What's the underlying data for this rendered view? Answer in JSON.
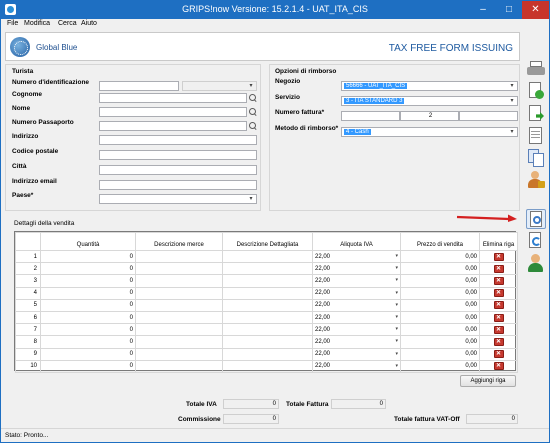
{
  "window": {
    "title": "GRIPS!now Versione: 15.2.1.4 - UAT_ITA_CIS"
  },
  "menu": {
    "items": [
      "File",
      "Modifica",
      "Cerca",
      "Aiuto"
    ]
  },
  "header": {
    "logo_text": "Global Blue",
    "form_title": "TAX FREE FORM ISSUING"
  },
  "tourist": {
    "section_label": "Turista",
    "fields": [
      {
        "label": "Numero d'identificazione",
        "value": ""
      },
      {
        "label": "Cognome",
        "value": ""
      },
      {
        "label": "Nome",
        "value": ""
      },
      {
        "label": "Numero Passaporto",
        "value": ""
      },
      {
        "label": "Indirizzo",
        "value": ""
      },
      {
        "label": "Codice postale",
        "value": ""
      },
      {
        "label": "Città",
        "value": ""
      },
      {
        "label": "Indirizzo email",
        "value": ""
      },
      {
        "label": "Paese*",
        "value": ""
      }
    ]
  },
  "refund": {
    "section_label": "Opzioni di rimborso",
    "negozio_label": "Negozio",
    "negozio_value": "56666 - UAT_ITA_CIS",
    "servizio_label": "Servizio",
    "servizio_value": "3 - ITA STANDARD 3",
    "numero_fattura_label": "Numero fattura*",
    "numero_fattura_parts": [
      "",
      "2",
      ""
    ],
    "metodo_label": "Metodo di rimborso*",
    "metodo_value": "4 - Cash"
  },
  "sales": {
    "section_label": "Dettagli della vendita",
    "columns": [
      "Quantità",
      "Descrizione merce",
      "Descrizione Dettagliata",
      "Aliquota IVA",
      "Prezzo di vendita",
      "Elimina riga"
    ],
    "rows": [
      {
        "n": "1",
        "qty": "0",
        "iva": "22,00",
        "price": "0,00"
      },
      {
        "n": "2",
        "qty": "0",
        "iva": "22,00",
        "price": "0,00"
      },
      {
        "n": "3",
        "qty": "0",
        "iva": "22,00",
        "price": "0,00"
      },
      {
        "n": "4",
        "qty": "0",
        "iva": "22,00",
        "price": "0,00"
      },
      {
        "n": "5",
        "qty": "0",
        "iva": "22,00",
        "price": "0,00"
      },
      {
        "n": "6",
        "qty": "0",
        "iva": "22,00",
        "price": "0,00"
      },
      {
        "n": "7",
        "qty": "0",
        "iva": "22,00",
        "price": "0,00"
      },
      {
        "n": "8",
        "qty": "0",
        "iva": "22,00",
        "price": "0,00"
      },
      {
        "n": "9",
        "qty": "0",
        "iva": "22,00",
        "price": "0,00"
      },
      {
        "n": "10",
        "qty": "0",
        "iva": "22,00",
        "price": "0,00"
      }
    ],
    "add_row_label": "Aggiungi riga"
  },
  "totals": {
    "totale_iva_label": "Totale IVA",
    "totale_iva_value": "0",
    "totale_fattura_label": "Totale Fattura",
    "totale_fattura_value": "0",
    "commissione_label": "Commissione",
    "commissione_value": "0",
    "totale_vat_off_label": "Totale fattura VAT-Off",
    "totale_vat_off_value": "0"
  },
  "status": {
    "text": "Stato: Pronto..."
  },
  "colors": {
    "title_bar": "#1e6fc2",
    "accent_blue": "#1e5aa0",
    "selection": "#3399ff",
    "arrow_red": "#d42020"
  }
}
